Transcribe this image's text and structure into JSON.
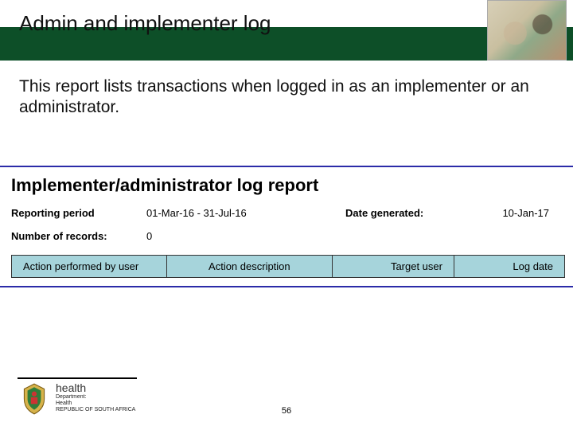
{
  "header": {
    "title": "Admin and implementer log"
  },
  "intro": "This report lists transactions when logged in as an implementer or an administrator.",
  "report": {
    "title": "Implementer/administrator log report",
    "period_label": "Reporting period",
    "period_value": "01-Mar-16 - 31-Jul-16",
    "generated_label": "Date generated:",
    "generated_value": "10-Jan-17",
    "records_label": "Number of records:",
    "records_value": "0",
    "columns": {
      "c1": "Action performed by user",
      "c2": "Action description",
      "c3": "Target user",
      "c4": "Log date"
    }
  },
  "footer": {
    "dept": "health",
    "line1": "Department:",
    "line2": "Health",
    "line3": "REPUBLIC OF SOUTH AFRICA",
    "page": "56"
  }
}
